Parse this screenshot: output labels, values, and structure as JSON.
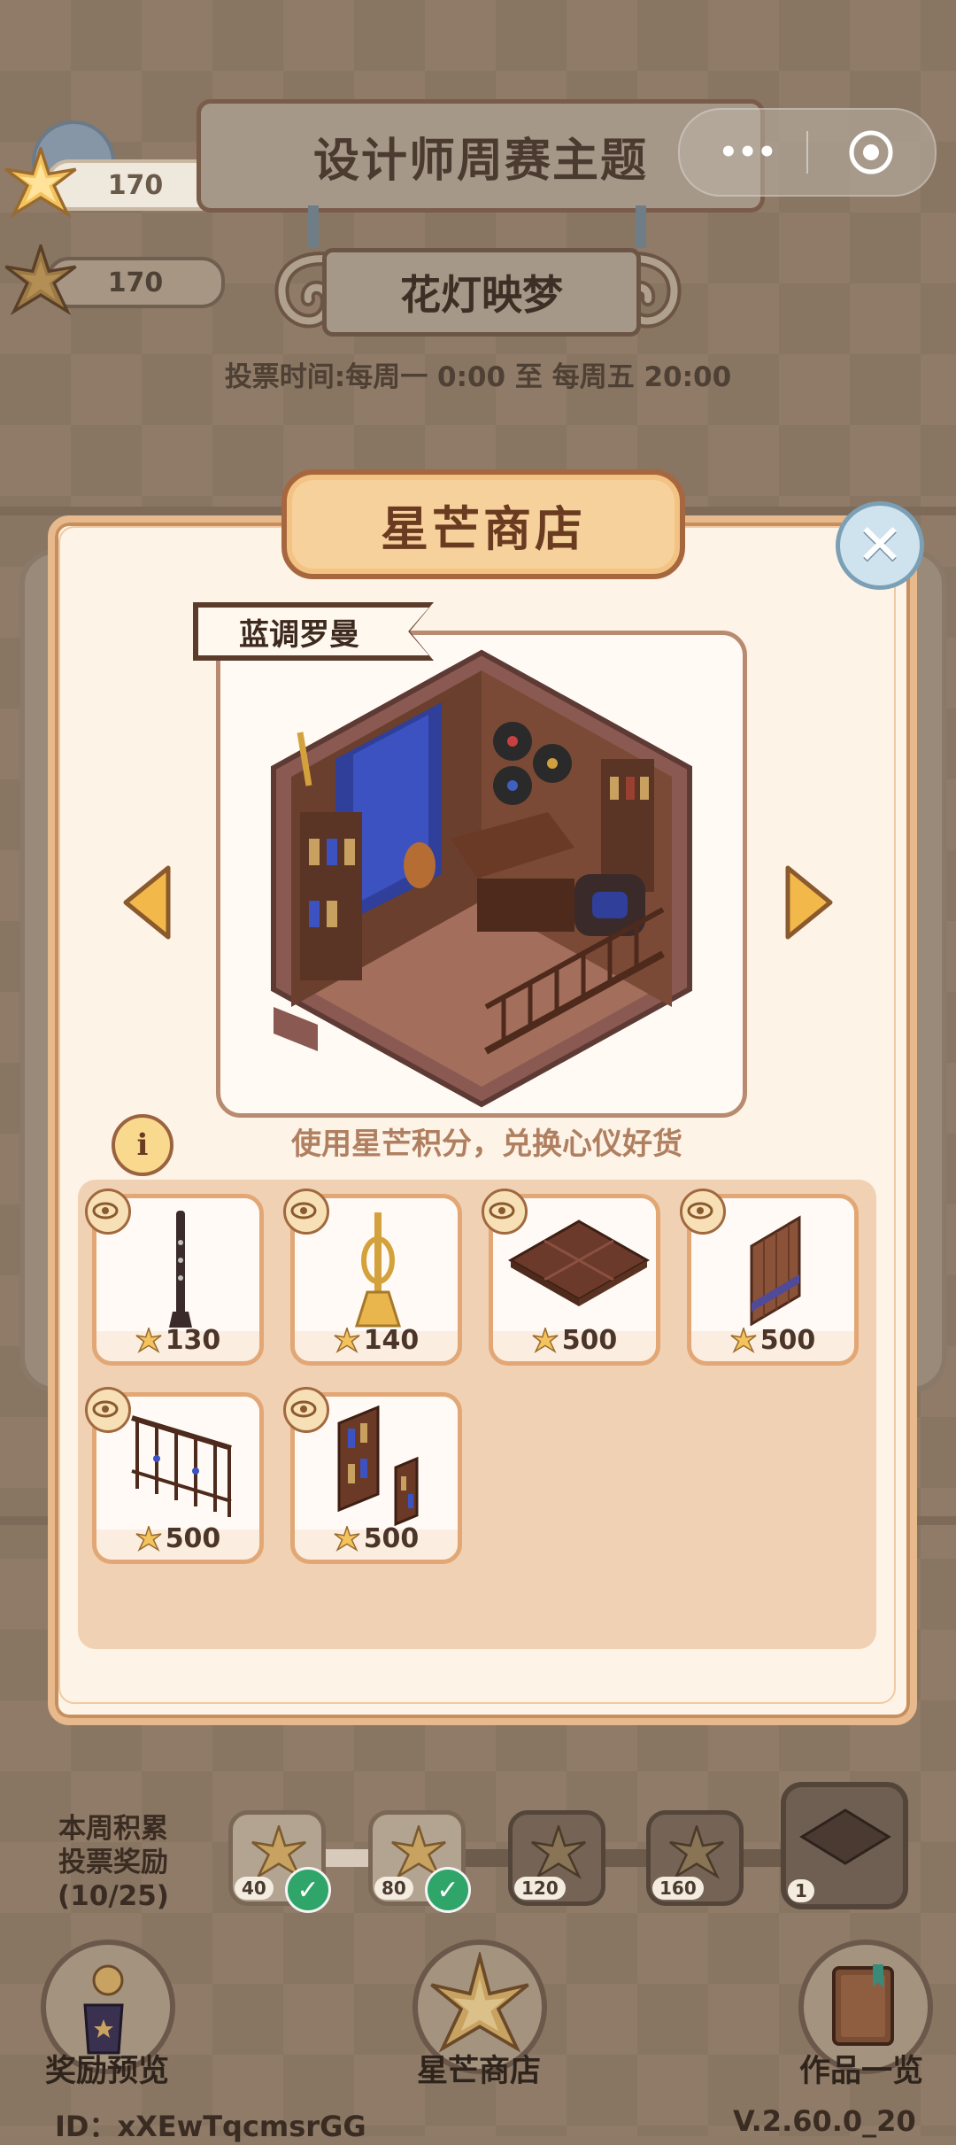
{
  "hud": {
    "star_points_a": "170",
    "star_points_b": "170"
  },
  "theme": {
    "title": "设计师周赛主题",
    "subtitle": "花灯映梦",
    "vote_time": "投票时间:每周一 0:00 至 每周五 20:00"
  },
  "shop": {
    "title": "星芒商店",
    "set_name": "蓝调罗曼",
    "hint": "使用星芒积分，兑换心仪好货",
    "info_glyph": "i",
    "close_glyph": "✕",
    "items": [
      {
        "price": "130",
        "icon": "clarinet-icon"
      },
      {
        "price": "140",
        "icon": "trumpet-icon"
      },
      {
        "price": "500",
        "icon": "wood-floor-tile-icon"
      },
      {
        "price": "500",
        "icon": "wood-wall-panel-icon"
      },
      {
        "price": "500",
        "icon": "stair-railing-icon"
      },
      {
        "price": "500",
        "icon": "bottle-shelf-wall-icon"
      }
    ]
  },
  "weekly_reward": {
    "label_line1": "本周积累",
    "label_line2": "投票奖励",
    "label_line3": "(10/25)",
    "progress": 0.4,
    "nodes": [
      {
        "value": "40",
        "claimed": true
      },
      {
        "value": "80",
        "claimed": true
      },
      {
        "value": "120",
        "claimed": false
      },
      {
        "value": "160",
        "claimed": false
      },
      {
        "value": "1",
        "claimed": false
      }
    ]
  },
  "bottom_nav": {
    "reward_preview": "奖励预览",
    "star_shop": "星芒商店",
    "works_list": "作品一览"
  },
  "footer": {
    "id_text": "ID：xXEwTqcmsrGG",
    "version": "V.2.60.0_20"
  },
  "colors": {
    "panel_bg": "#fdf3e6",
    "panel_border": "#e7b98c",
    "header_gold": "#f6d19b",
    "star_gold": "#e8b64c",
    "claimed_green": "#2fa56a"
  }
}
